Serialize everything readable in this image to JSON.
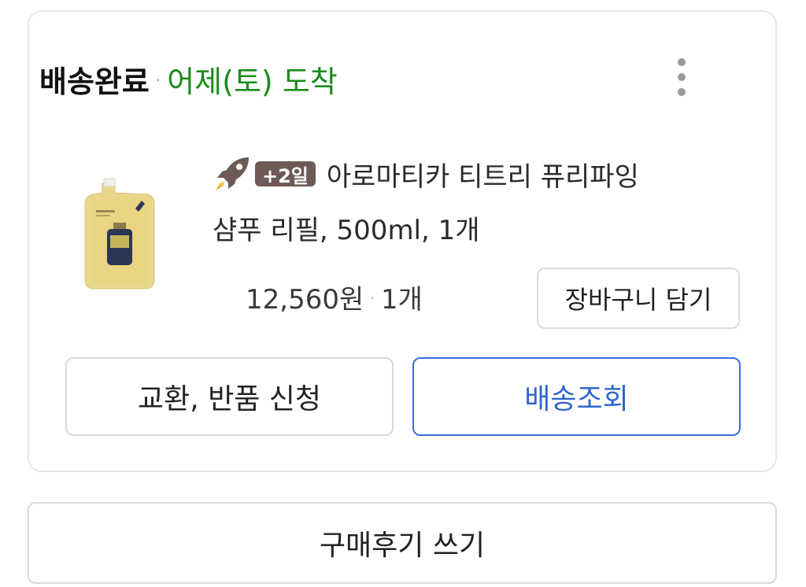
{
  "order": {
    "status": "배송완료",
    "separator": "·",
    "arrival": "어제(토) 도착",
    "more_icon": "more-vertical-icon"
  },
  "product": {
    "shipping_icon": "rocket-icon",
    "badge": "+2일",
    "name_line1": "아로마티카 티트리 퓨리파잉",
    "name_line2": "샴푸 리필, 500ml, 1개",
    "price": "12,560원",
    "separator": "·",
    "quantity": "1개",
    "cart_button": "장바구니 담기"
  },
  "actions": {
    "exchange_return": "교환, 반품 신청",
    "track_delivery": "배송조회",
    "write_review": "구매후기 쓰기"
  },
  "colors": {
    "arrival_green": "#1b8b1b",
    "track_blue": "#2f66cf",
    "badge_brown": "#6d5a57"
  }
}
